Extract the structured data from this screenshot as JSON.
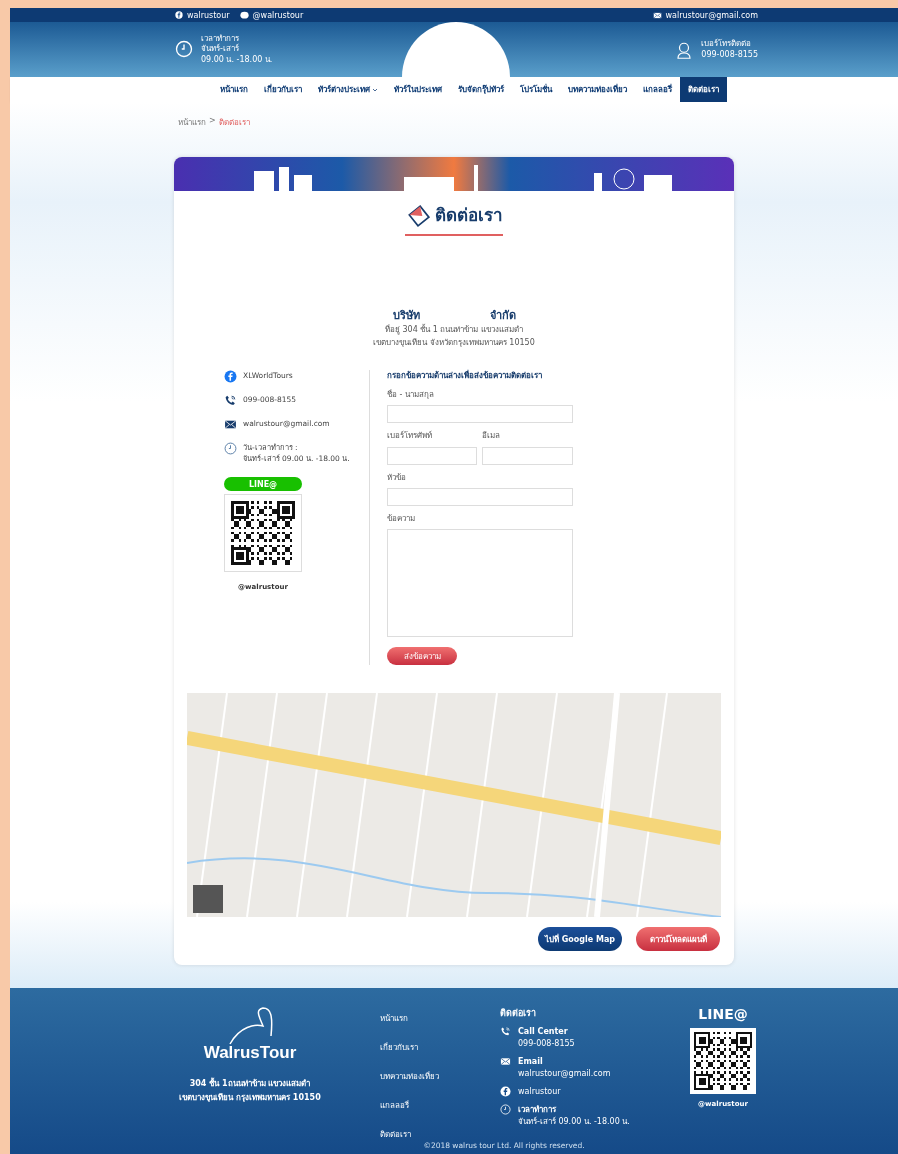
{
  "topbar": {
    "facebook": "walrustour",
    "line": "@walrustour",
    "email": "walrustour@gmail.com"
  },
  "header": {
    "hours_label": "เวลาทำการ",
    "hours_days": "จันทร์-เสาร์",
    "hours_time": "09.00 น. -18.00 น.",
    "phone_label": "เบอร์โทรติดต่อ",
    "phone": "099-008-8155"
  },
  "nav": [
    {
      "label": "หน้าแรก",
      "selected": false,
      "dropdown": false
    },
    {
      "label": "เกี่ยวกับเรา",
      "selected": false,
      "dropdown": false
    },
    {
      "label": "ทัวร์ต่างประเทศ",
      "selected": false,
      "dropdown": true
    },
    {
      "label": "ทัวร์ในประเทศ",
      "selected": false,
      "dropdown": false
    },
    {
      "label": "รับจัดกรุ๊ปทัวร์",
      "selected": false,
      "dropdown": false
    },
    {
      "label": "โปรโมชั่น",
      "selected": false,
      "dropdown": false
    },
    {
      "label": "บทความท่องเที่ยว",
      "selected": false,
      "dropdown": false
    },
    {
      "label": "แกลลอรี่",
      "selected": false,
      "dropdown": false
    },
    {
      "label": "ติดต่อเรา",
      "selected": true,
      "dropdown": false
    }
  ],
  "breadcrumb": [
    {
      "label": "หน้าแรก",
      "current": false
    },
    {
      "label": "ติดต่อเรา",
      "current": true
    }
  ],
  "breadcrumb_separator": ">",
  "page_title": "ติดต่อเรา",
  "company": {
    "name_start": "บริษัท",
    "name_end": "จำกัด",
    "address_1": "ที่อยู่ 304 ชั้น 1 ถนนท่าข้าม แขวงแสมดำ",
    "address_2": "เขตบางขุนเทียน จังหวัดกรุงเทพมหานคร 10150"
  },
  "contacts": [
    {
      "kind": "facebook",
      "text": "XLWorldTours"
    },
    {
      "kind": "phone",
      "text": "099-008-8155"
    },
    {
      "kind": "email",
      "text": "walrustour@gmail.com"
    },
    {
      "kind": "hours",
      "text": "วัน-เวลาทำการ :",
      "subtext": "จันทร์-เสาร์ 09.00 น. -18.00 น."
    }
  ],
  "line_badge": "LINE@",
  "line_id": "@walrustour",
  "form": {
    "title": "กรอกข้อความด้านล่างเพื่อส่งข้อความติดต่อเรา",
    "name_label": "ชื่อ - นามสกุล",
    "phone_label": "เบอร์โทรศัพท์",
    "email_label": "อีเมล",
    "subject_label": "หัวข้อ",
    "message_label": "ข้อความ",
    "submit": "ส่งข้อความ"
  },
  "map_buttons": [
    {
      "kind": "primary",
      "label": "ไปที่ Google Map"
    },
    {
      "kind": "danger",
      "label": "ดาวน์โหลดแผนที่"
    }
  ],
  "footer": {
    "logo": "WalrusTour",
    "address_1": "304 ชั้น 1ถนนท่าข้าม แขวงแสมดำ",
    "address_2": "เขตบางขุนเทียน กรุงเทพมหานคร 10150",
    "links": [
      "หน้าแรก",
      "เกี่ยวกับเรา",
      "บทความท่องเที่ยว",
      "แกลลอรี่",
      "ติดต่อเรา"
    ],
    "contact_title": "ติดต่อเรา",
    "contacts": [
      {
        "kind": "phone",
        "title": "Call Center",
        "text": "099-008-8155"
      },
      {
        "kind": "email",
        "title": "Email",
        "text": "walrustour@gmail.com"
      },
      {
        "kind": "facebook",
        "text": "walrustour"
      },
      {
        "kind": "hours",
        "title": "เวลาทำการ",
        "text": "จันทร์-เสาร์ 09.00 น. -18.00 น."
      }
    ],
    "line_title": "LINE@",
    "line_id": "@walrustour",
    "copyright": "©2018 walrus tour Ltd. All rights reserved."
  }
}
